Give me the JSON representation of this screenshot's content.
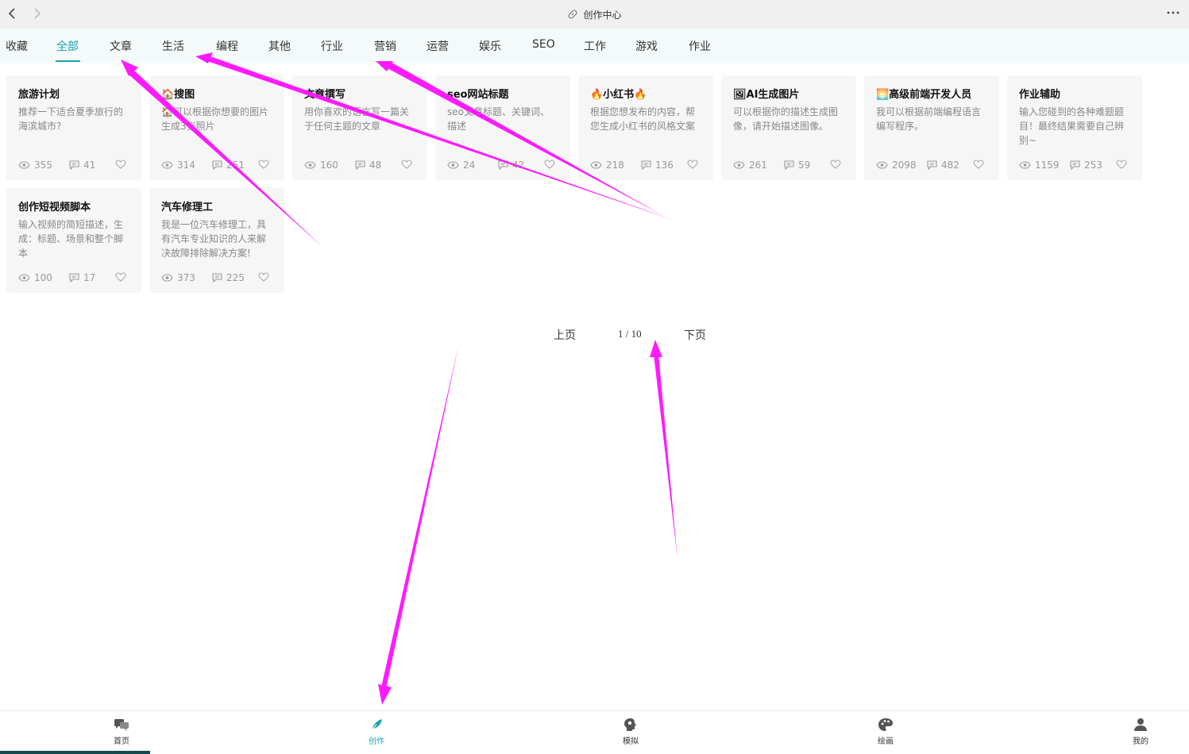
{
  "window": {
    "title": "创作中心"
  },
  "tabs": [
    {
      "label": "收藏",
      "active": false
    },
    {
      "label": "全部",
      "active": true
    },
    {
      "label": "文章",
      "active": false
    },
    {
      "label": "生活",
      "active": false
    },
    {
      "label": "编程",
      "active": false
    },
    {
      "label": "其他",
      "active": false
    },
    {
      "label": "行业",
      "active": false
    },
    {
      "label": "营销",
      "active": false
    },
    {
      "label": "运营",
      "active": false
    },
    {
      "label": "娱乐",
      "active": false
    },
    {
      "label": "SEO",
      "active": false
    },
    {
      "label": "工作",
      "active": false
    },
    {
      "label": "游戏",
      "active": false
    },
    {
      "label": "作业",
      "active": false
    }
  ],
  "cards": [
    {
      "title": "旅游计划",
      "desc": "推荐一下适合夏季旅行的海滨城市?",
      "views": "355",
      "comments": "41"
    },
    {
      "title": "🏠搜图",
      "desc": "🏠可以根据你想要的图片生成3张照片",
      "views": "314",
      "comments": "251"
    },
    {
      "title": "文章撰写",
      "desc": "用你喜欢的语言写一篇关于任何主题的文章",
      "views": "160",
      "comments": "48"
    },
    {
      "title": "seo网站标题",
      "desc": "seo文章标题、关键词、描述",
      "views": "24",
      "comments": "42"
    },
    {
      "title": "🔥小红书🔥",
      "desc": "根据您想发布的内容，帮您生成小红书的风格文案",
      "views": "218",
      "comments": "136"
    },
    {
      "title": "🖼AI生成图片",
      "desc": "可以根据你的描述生成图像，请开始描述图像。",
      "views": "261",
      "comments": "59"
    },
    {
      "title": "🌅高级前端开发人员",
      "desc": "我可以根据前端编程语言编写程序。",
      "views": "2098",
      "comments": "482"
    },
    {
      "title": "作业辅助",
      "desc": "输入您碰到的各种难题题目！最终结果需要自己辨别~",
      "views": "1159",
      "comments": "253"
    },
    {
      "title": "创作短视频脚本",
      "desc": "输入视频的简短描述，生成：标题、场景和整个脚本",
      "views": "100",
      "comments": "17"
    },
    {
      "title": "汽车修理工",
      "desc": "我是一位汽车修理工，具有汽车专业知识的人来解决故障排除解决方案!",
      "views": "373",
      "comments": "225"
    }
  ],
  "pagination": {
    "prev": "上页",
    "page": "1 / 10",
    "next": "下页"
  },
  "bottom_nav": [
    {
      "label": "首页",
      "icon": "chat-bubbles-icon",
      "active": false
    },
    {
      "label": "创作",
      "icon": "feather-icon",
      "active": true
    },
    {
      "label": "模拟",
      "icon": "head-profile-icon",
      "active": false
    },
    {
      "label": "绘画",
      "icon": "palette-icon",
      "active": false
    },
    {
      "label": "我的",
      "icon": "user-icon",
      "active": false
    }
  ],
  "colors": {
    "accent": "#1aa2b2",
    "annotation": "#ff1aff",
    "card_bg": "#f6f6f6"
  }
}
